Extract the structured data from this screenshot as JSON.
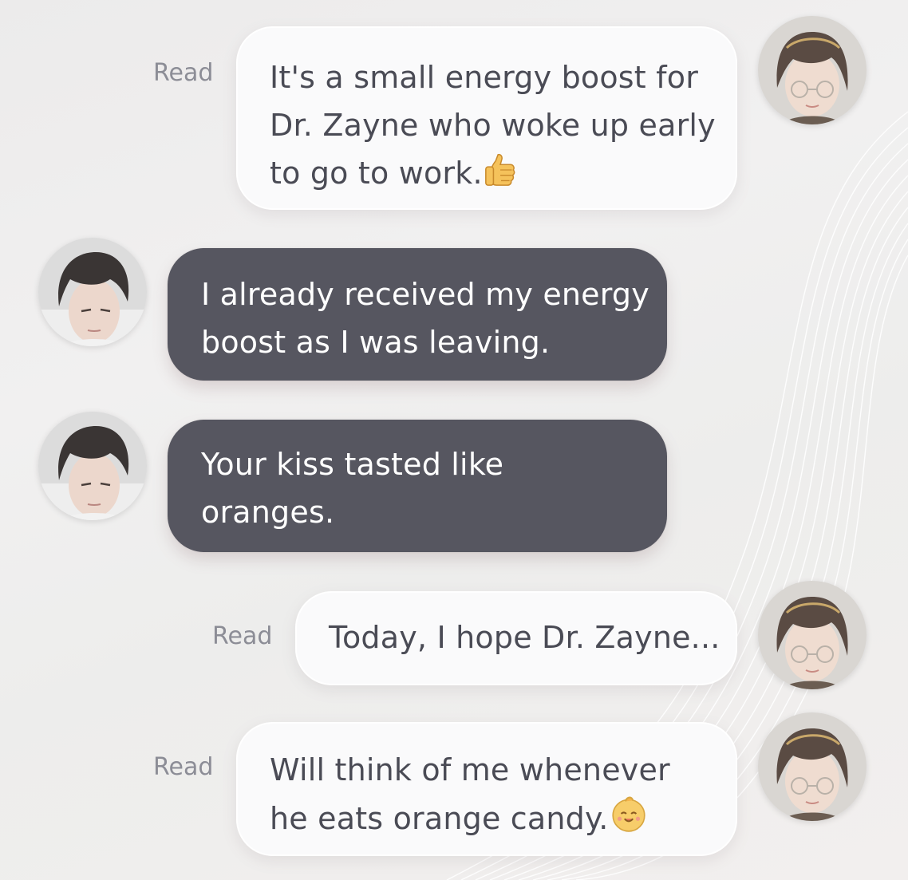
{
  "chat": {
    "messages": [
      {
        "sender": "me",
        "status": "Read",
        "lines": [
          "It's a small energy boost for",
          "Dr. Zayne who woke up early",
          "to go to work."
        ],
        "emoji": "thumbs-up-icon"
      },
      {
        "sender": "Zayne",
        "lines": [
          "I already received my energy",
          "boost as I was leaving."
        ]
      },
      {
        "sender": "Zayne",
        "lines": [
          "Your kiss tasted like",
          "oranges."
        ]
      },
      {
        "sender": "me",
        "status": "Read",
        "lines": [
          "Today, I hope Dr. Zayne..."
        ]
      },
      {
        "sender": "me",
        "status": "Read",
        "lines": [
          "Will think of me whenever",
          "he eats orange candy."
        ],
        "emoji": "smiling-orange-candy-icon"
      }
    ]
  },
  "colors": {
    "incoming_bubble": "#565660",
    "outgoing_bubble": "#fafafb",
    "outgoing_text": "#4a4b55",
    "read_status": "#8c8d96"
  }
}
